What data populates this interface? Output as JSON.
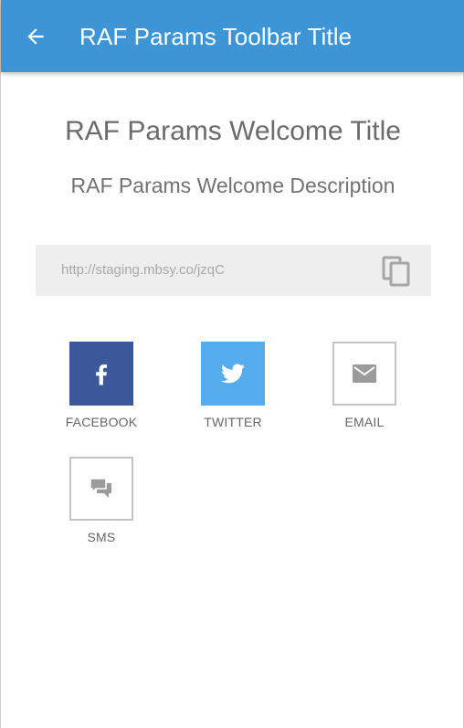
{
  "toolbar": {
    "title": "RAF Params Toolbar Title",
    "background_color": "#3d95d5",
    "back_icon": "arrow-left-icon"
  },
  "welcome": {
    "title": "RAF Params Welcome Title",
    "description": "RAF Params Welcome Description"
  },
  "share_link": {
    "url": "http://staging.mbsy.co/jzqC",
    "copy_icon": "copy-icon"
  },
  "share_options": [
    {
      "label": "FACEBOOK",
      "icon": "facebook-icon",
      "color": "#3b5998"
    },
    {
      "label": "TWITTER",
      "icon": "twitter-icon",
      "color": "#55acee"
    },
    {
      "label": "EMAIL",
      "icon": "envelope-icon",
      "color": "#c4c4c4"
    },
    {
      "label": "SMS",
      "icon": "chat-bubbles-icon",
      "color": "#c4c4c4"
    }
  ]
}
